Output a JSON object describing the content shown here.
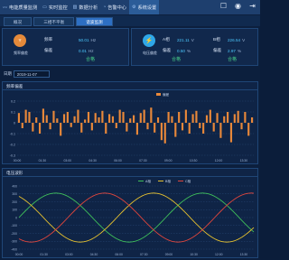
{
  "nav": {
    "items": [
      {
        "label": "电能质量监测",
        "icon": "activity-icon"
      },
      {
        "label": "实时监控",
        "icon": "monitor-icon"
      },
      {
        "label": "数据分析",
        "icon": "bar-chart-icon"
      },
      {
        "label": "告警中心",
        "icon": "bell-icon"
      },
      {
        "label": "系统设置",
        "icon": "settings-icon"
      }
    ],
    "active_index": 4,
    "right_icons": [
      "message-icon",
      "user-icon",
      "exit-icon"
    ]
  },
  "tabs": {
    "items": [
      "概况",
      "三相不平衡",
      "谐波监测"
    ],
    "active_index": 2
  },
  "metrics": {
    "frequency": {
      "label": "频率偏差",
      "icon": "frequency-icon",
      "color": "#e58a3a",
      "rows": [
        {
          "label": "频率",
          "value": "50.01",
          "unit": "Hz"
        },
        {
          "label": "偏差",
          "value": "0.01",
          "unit": "Hz"
        }
      ],
      "status": "合格"
    },
    "voltage": {
      "label": "电压偏差",
      "icon": "voltage-icon",
      "color": "#2fa8e8",
      "rows": [
        {
          "label": "A相",
          "value": "221.11",
          "unit": "V"
        },
        {
          "label": "偏差",
          "value": "0.50",
          "unit": "%"
        }
      ],
      "rows2": [
        {
          "label": "B相",
          "value": "226.54",
          "unit": "V"
        },
        {
          "label": "偏差",
          "value": "2.97",
          "unit": "%"
        }
      ],
      "status": "合格",
      "status2": "合格"
    }
  },
  "date": {
    "label": "日期",
    "value": "2019-11-07"
  },
  "bar_panel": {
    "title": "频率偏差",
    "legend": "偏差"
  },
  "line_panel": {
    "title": "电压波形",
    "legend": [
      "A相",
      "B相",
      "C相"
    ]
  },
  "chart_data": [
    {
      "type": "bar",
      "title": "频率偏差",
      "ylim": [
        -0.3,
        0.2
      ],
      "yticks": [
        0.2,
        0.1,
        0,
        -0.1,
        -0.2,
        -0.3
      ],
      "xticks": [
        "00:00",
        "01:30",
        "03:00",
        "04:30",
        "06:00",
        "07:30",
        "09:00",
        "10:30",
        "12:00",
        "13:30"
      ],
      "series": [
        {
          "name": "偏差",
          "color": "#e8883a",
          "values": [
            0.09,
            -0.05,
            0.12,
            0.1,
            -0.08,
            0.05,
            -0.1,
            0.13,
            0.07,
            -0.06,
            0.11,
            0.04,
            -0.12,
            0.08,
            0.1,
            -0.04,
            0.06,
            0.12,
            -0.09,
            0.03,
            0.1,
            -0.07,
            0.09,
            0.05,
            0.11,
            -0.1,
            0.08,
            0.06,
            -0.05,
            0.12,
            0.1,
            -0.08,
            0.04,
            0.07,
            -0.11,
            0.09,
            0.12,
            -0.06,
            0.14,
            -0.09,
            0.05,
            -0.16,
            -0.19,
            0.1,
            0.06,
            -0.13,
            0.1,
            -0.07,
            0.12,
            -0.1,
            0.08,
            0.11,
            -0.05,
            -0.1,
            0.07,
            0.12,
            -0.08,
            0.09,
            -0.14,
            0.06,
            0.1,
            -0.18,
            0.08,
            0.11,
            -0.06,
            0.1,
            -0.12,
            0.05
          ]
        }
      ]
    },
    {
      "type": "line",
      "title": "电压波形",
      "ylim": [
        -400,
        400
      ],
      "yticks": [
        400,
        300,
        200,
        100,
        0,
        -100,
        -200,
        -300,
        -400
      ],
      "xticks": [
        "00:00",
        "01:30",
        "03:00",
        "04:30",
        "06:00",
        "07:30",
        "09:00",
        "10:30",
        "12:00",
        "13:30"
      ],
      "series": [
        {
          "name": "A相",
          "color": "#3fbf5a",
          "phase_deg": 0
        },
        {
          "name": "B相",
          "color": "#e6c12f",
          "phase_deg": 120
        },
        {
          "name": "C相",
          "color": "#e0463c",
          "phase_deg": 240
        }
      ],
      "amplitude": 310,
      "cycles": 1.6
    }
  ]
}
